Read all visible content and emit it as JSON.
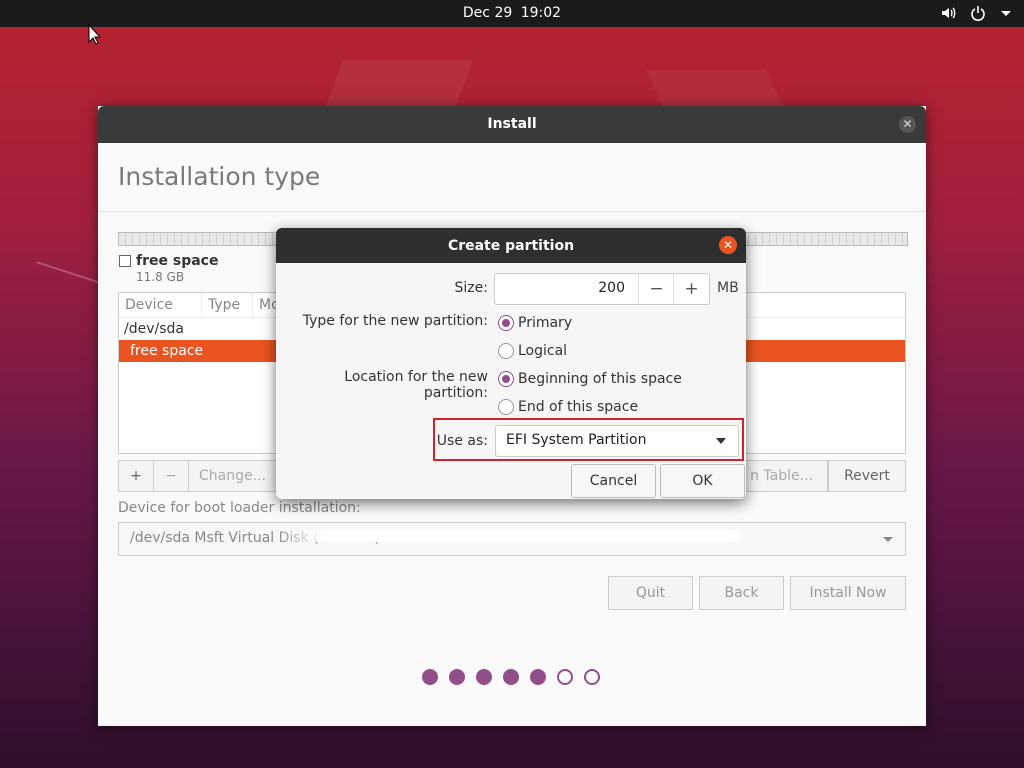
{
  "topbar": {
    "date": "Dec 29",
    "time": "19:02",
    "icons": [
      "volume-icon",
      "power-icon",
      "menu-arrow-icon"
    ]
  },
  "window": {
    "title": "Install",
    "page_title": "Installation type",
    "legend": {
      "name": "free space",
      "size": "11.8 GB"
    },
    "table": {
      "headers": [
        "Device",
        "Type",
        "Mo"
      ],
      "rows": [
        "/dev/sda",
        "free space"
      ],
      "selected_row": 1
    },
    "toolbar": {
      "add": "+",
      "remove": "−",
      "change": "Change...",
      "new_table": "n Table...",
      "revert": "Revert"
    },
    "boot_label": "Device for boot loader installation:",
    "boot_device": "/dev/sda Msft Virtual Disk (11.8 GB)",
    "buttons": {
      "quit": "Quit",
      "back": "Back",
      "install": "Install Now"
    },
    "progress": {
      "total": 7,
      "completed": 5
    },
    "accent": "#e95420",
    "purple": "#924d8b"
  },
  "dialog": {
    "title": "Create partition",
    "size_label": "Size:",
    "size_value": "200",
    "size_unit": "MB",
    "decrement": "−",
    "increment": "+",
    "type_label": "Type for the new partition:",
    "type_primary": "Primary",
    "type_logical": "Logical",
    "location_label": "Location for the new partition:",
    "location_begin": "Beginning of this space",
    "location_end": "End of this space",
    "use_as_label": "Use as:",
    "use_as_value": "EFI System Partition",
    "cancel": "Cancel",
    "ok": "OK"
  }
}
